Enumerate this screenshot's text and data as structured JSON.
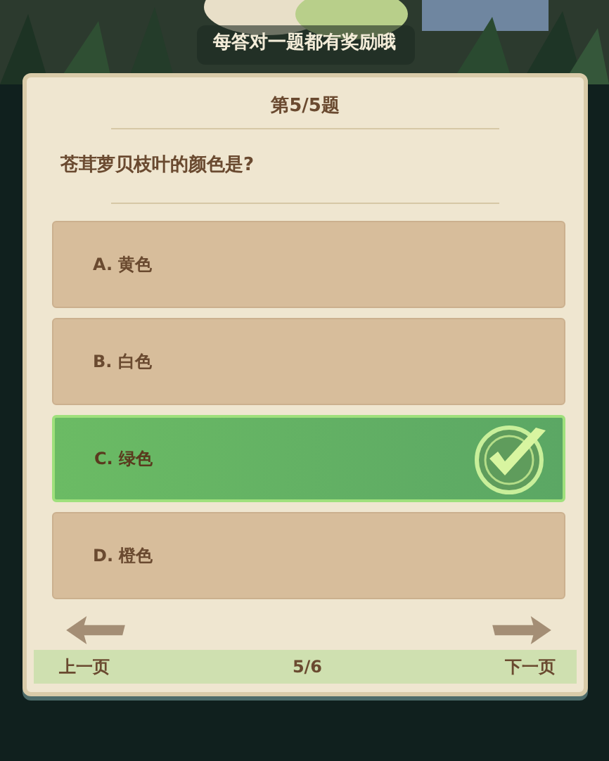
{
  "banner": "每答对一题都有奖励哦",
  "quiz": {
    "title": "第5/5题",
    "question": "苍茸萝贝枝叶的颜色是?",
    "options": [
      {
        "label": "A. 黄色",
        "selected": false
      },
      {
        "label": "B. 白色",
        "selected": false
      },
      {
        "label": "C. 绿色",
        "selected": true
      },
      {
        "label": "D. 橙色",
        "selected": false
      }
    ]
  },
  "footer": {
    "prev": "上一页",
    "page": "5/6",
    "next": "下一页"
  }
}
